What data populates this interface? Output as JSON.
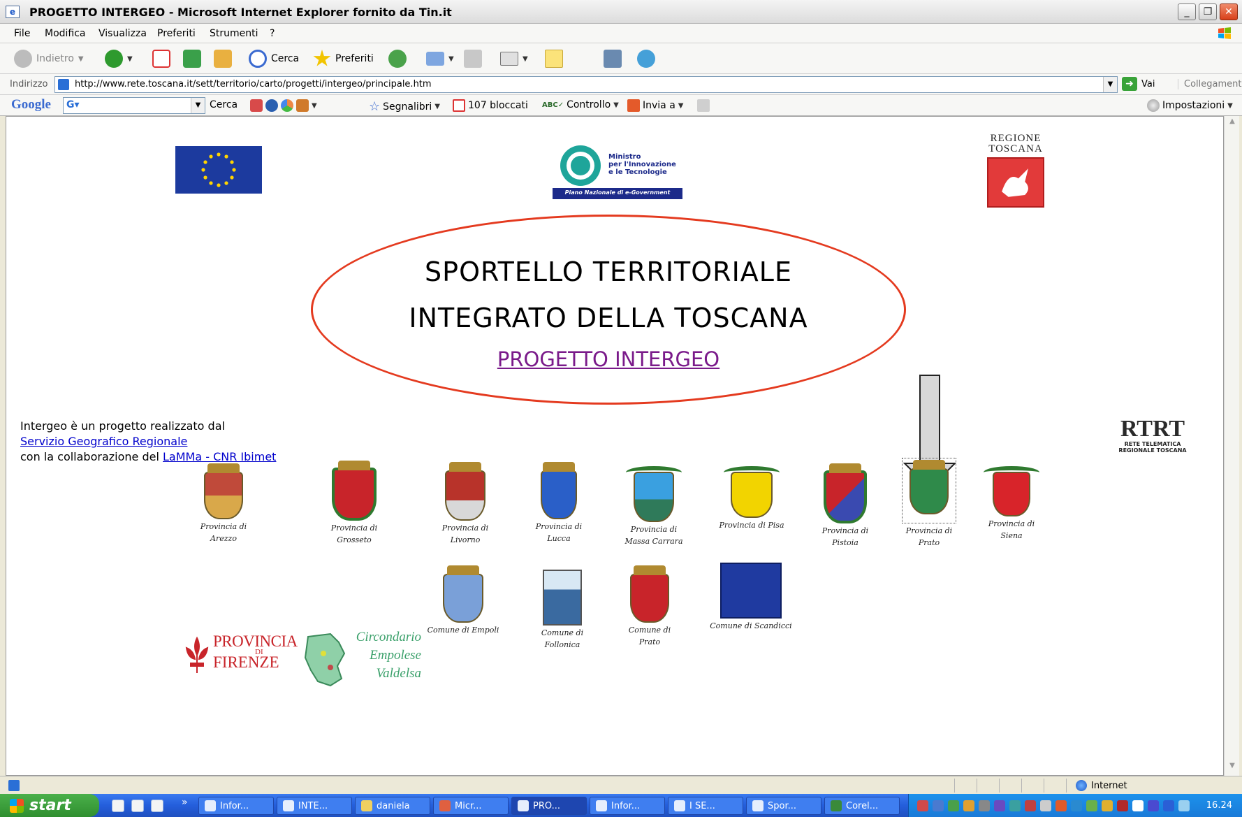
{
  "window": {
    "title": "PROGETTO INTERGEO - Microsoft Internet Explorer fornito da Tin.it",
    "minimize": "_",
    "maximize": "❐",
    "close": "✕"
  },
  "menu": [
    "File",
    "Modifica",
    "Visualizza",
    "Preferiti",
    "Strumenti",
    "?"
  ],
  "toolbar": {
    "back": "Indietro",
    "search": "Cerca",
    "favorites": "Preferiti"
  },
  "address": {
    "label": "Indirizzo",
    "url": "http://www.rete.toscana.it/sett/territorio/carto/progetti/intergeo/principale.htm",
    "go": "Vai",
    "links": "Collegamenti"
  },
  "google_bar": {
    "logo": "Google",
    "search_btn": "Cerca",
    "bookmarks": "Segnalibri",
    "blocked": "107 bloccati",
    "spellcheck": "Controllo",
    "send": "Invia a",
    "settings": "Impostazioni"
  },
  "page": {
    "regione_text": "REGIONE TOSCANA",
    "ministry_lines": [
      "Ministro",
      "per l'Innovazione",
      "e le Tecnologie"
    ],
    "ministry_band": "Piano Nazionale di e-Government",
    "title_line1": "SPORTELLO TERRITORIALE",
    "title_line2": "INTEGRATO DELLA TOSCANA",
    "project_link": "PROGETTO INTERGEO",
    "intro_line1": "Intergeo è un progetto realizzato dal",
    "intro_link1": "Servizio Geografico Regionale",
    "intro_line3_prefix": "con la collaborazione del ",
    "intro_link2": "LaMMa - CNR Ibimet",
    "rtrt_big": "RTRT",
    "rtrt_small1": "RETE TELEMATICA",
    "rtrt_small2": "REGIONALE TOSCANA",
    "row1": [
      {
        "l1": "Provincia di",
        "l2": "Arezzo"
      },
      {
        "l1": "Provincia di",
        "l2": "Grosseto"
      },
      {
        "l1": "Provincia di",
        "l2": "Livorno"
      },
      {
        "l1": "Provincia di",
        "l2": "Lucca"
      },
      {
        "l1": "Provincia di",
        "l2": "Massa Carrara"
      },
      {
        "l1": "Provincia di Pisa",
        "l2": ""
      },
      {
        "l1": "Provincia di",
        "l2": "Pistoia"
      },
      {
        "l1": "Provincia di",
        "l2": "Prato"
      },
      {
        "l1": "Provincia di",
        "l2": "Siena"
      }
    ],
    "firenze_1": "PROVINCIA",
    "firenze_2": "FIRENZE",
    "firenze_di": "DI",
    "empolese": [
      "Circondario",
      "Empolese",
      "Valdelsa"
    ],
    "row2": [
      {
        "l1": "Comune di Empoli",
        "l2": ""
      },
      {
        "l1": "Comune di",
        "l2": "Follonica"
      },
      {
        "l1": "Comune di",
        "l2": "Prato"
      },
      {
        "l1": "Comune di Scandicci",
        "l2": ""
      }
    ]
  },
  "status": {
    "zone": "Internet"
  },
  "taskbar": {
    "start": "start",
    "tasks": [
      "Infor...",
      "INTE...",
      "daniela",
      "Micr...",
      "PRO...",
      "Infor...",
      "I SE...",
      "Spor...",
      "Corel..."
    ],
    "clock": "16.24"
  },
  "colors": {
    "ellipse": "#e43a1f",
    "link_visited": "#7a1a8a",
    "link": "#0000cc",
    "regione_red": "#e23a3a",
    "eu_blue": "#1c3a9e"
  }
}
